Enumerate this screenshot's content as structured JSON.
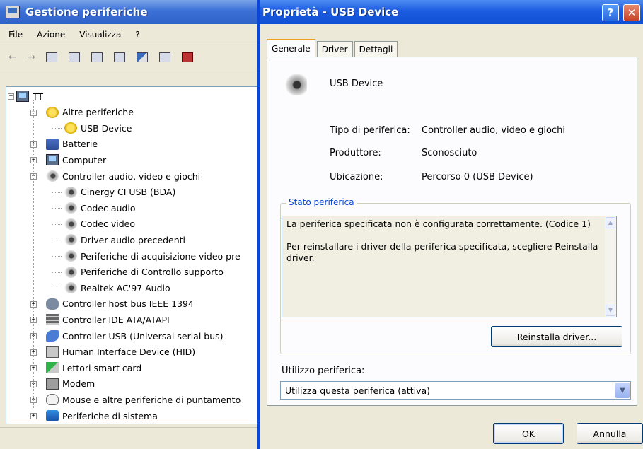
{
  "device_manager": {
    "title": "Gestione periferiche",
    "menu": [
      "File",
      "Azione",
      "Visualizza",
      "?"
    ],
    "tree": [
      {
        "label": "TT",
        "icon": "computer-icon",
        "level": 0,
        "expander": "−"
      },
      {
        "label": "Altre periferiche",
        "icon": "unknown-device-icon",
        "level": 1,
        "expander": "−"
      },
      {
        "label": "USB Device",
        "icon": "unknown-device-icon",
        "level": 2,
        "expander": ""
      },
      {
        "label": "Batterie",
        "icon": "battery-icon",
        "level": 1,
        "expander": "+"
      },
      {
        "label": "Computer",
        "icon": "computer-icon",
        "level": 1,
        "expander": "+"
      },
      {
        "label": "Controller audio, video e giochi",
        "icon": "speaker-icon",
        "level": 1,
        "expander": "−"
      },
      {
        "label": "Cinergy CI USB (BDA)",
        "icon": "speaker-icon",
        "level": 2,
        "expander": ""
      },
      {
        "label": "Codec audio",
        "icon": "speaker-icon",
        "level": 2,
        "expander": ""
      },
      {
        "label": "Codec video",
        "icon": "speaker-icon",
        "level": 2,
        "expander": ""
      },
      {
        "label": "Driver audio precedenti",
        "icon": "speaker-icon",
        "level": 2,
        "expander": ""
      },
      {
        "label": "Periferiche di acquisizione video pre",
        "icon": "speaker-icon",
        "level": 2,
        "expander": ""
      },
      {
        "label": "Periferiche di Controllo supporto",
        "icon": "speaker-icon",
        "level": 2,
        "expander": ""
      },
      {
        "label": "Realtek AC'97 Audio",
        "icon": "speaker-icon",
        "level": 2,
        "expander": ""
      },
      {
        "label": "Controller host bus IEEE 1394",
        "icon": "firewire-icon",
        "level": 1,
        "expander": "+"
      },
      {
        "label": "Controller IDE ATA/ATAPI",
        "icon": "ide-icon",
        "level": 1,
        "expander": "+"
      },
      {
        "label": "Controller USB (Universal serial bus)",
        "icon": "usb-icon",
        "level": 1,
        "expander": "+"
      },
      {
        "label": "Human Interface Device (HID)",
        "icon": "hid-icon",
        "level": 1,
        "expander": "+"
      },
      {
        "label": "Lettori smart card",
        "icon": "smart-card-icon",
        "level": 1,
        "expander": "+"
      },
      {
        "label": "Modem",
        "icon": "modem-icon",
        "level": 1,
        "expander": "+"
      },
      {
        "label": "Mouse e altre periferiche di puntamento",
        "icon": "mouse-icon",
        "level": 1,
        "expander": "+"
      },
      {
        "label": "Periferiche di sistema",
        "icon": "system-device-icon",
        "level": 1,
        "expander": "+"
      }
    ]
  },
  "dialog": {
    "title": "Proprietà - USB Device",
    "help_glyph": "?",
    "close_glyph": "✕",
    "tabs": [
      "Generale",
      "Driver",
      "Dettagli"
    ],
    "device_name": "USB Device",
    "properties": [
      {
        "label": "Tipo di periferica:",
        "value": "Controller audio, video e giochi"
      },
      {
        "label": "Produttore:",
        "value": "Sconosciuto"
      },
      {
        "label": "Ubicazione:",
        "value": "Percorso 0 (USB Device)"
      }
    ],
    "status_group_title": "Stato periferica",
    "status_line1": "La periferica specificata non è configurata correttamente. (Codice 1)",
    "status_line2": "Per reinstallare i driver della periferica specificata, scegliere Reinstalla driver.",
    "reinstall_button": "Reinstalla driver...",
    "usage_label": "Utilizzo periferica:",
    "usage_value": "Utilizza questa periferica (attiva)",
    "ok_button": "OK",
    "cancel_button": "Annulla"
  }
}
